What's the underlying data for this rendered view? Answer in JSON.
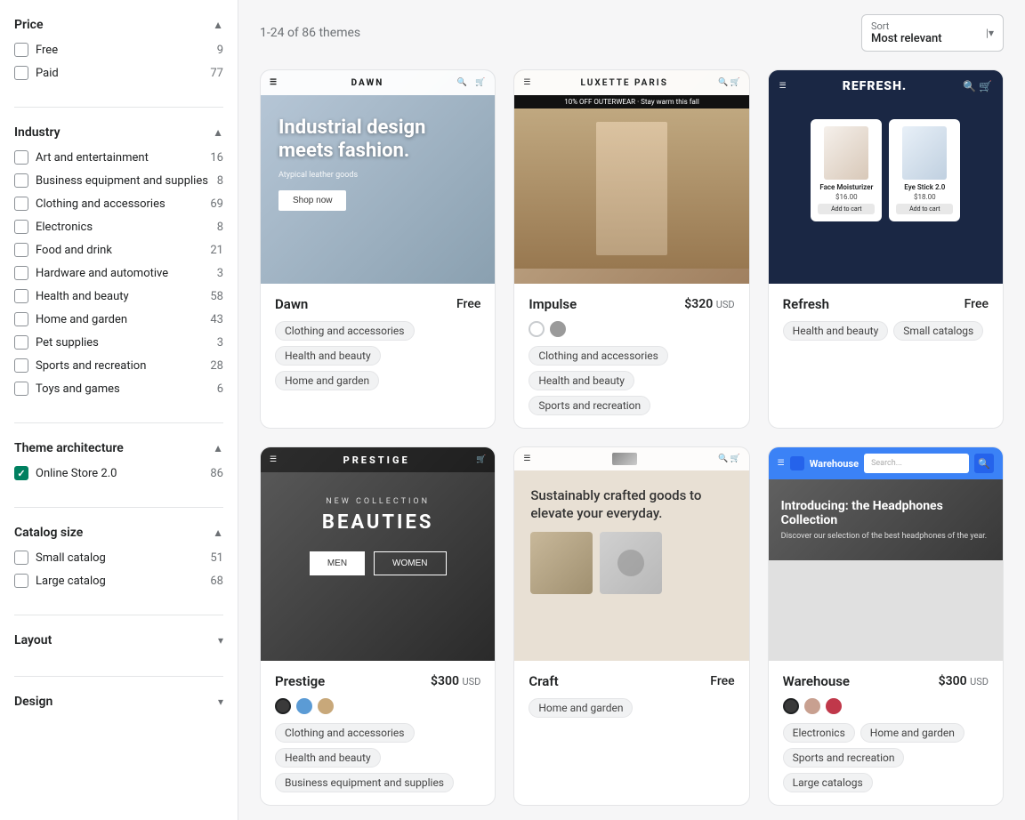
{
  "sidebar": {
    "price_title": "Price",
    "price_items": [
      {
        "label": "Free",
        "count": 9,
        "checked": false
      },
      {
        "label": "Paid",
        "count": 77,
        "checked": false
      }
    ],
    "industry_title": "Industry",
    "industry_items": [
      {
        "label": "Art and entertainment",
        "count": 16,
        "checked": false
      },
      {
        "label": "Business equipment and supplies",
        "count": 8,
        "checked": false
      },
      {
        "label": "Clothing and accessories",
        "count": 69,
        "checked": false
      },
      {
        "label": "Electronics",
        "count": 8,
        "checked": false
      },
      {
        "label": "Food and drink",
        "count": 21,
        "checked": false
      },
      {
        "label": "Hardware and automotive",
        "count": 3,
        "checked": false
      },
      {
        "label": "Health and beauty",
        "count": 58,
        "checked": false
      },
      {
        "label": "Home and garden",
        "count": 43,
        "checked": false
      },
      {
        "label": "Pet supplies",
        "count": 3,
        "checked": false
      },
      {
        "label": "Sports and recreation",
        "count": 28,
        "checked": false
      },
      {
        "label": "Toys and games",
        "count": 6,
        "checked": false
      }
    ],
    "theme_arch_title": "Theme architecture",
    "theme_arch_items": [
      {
        "label": "Online Store 2.0",
        "count": 86,
        "checked": true
      }
    ],
    "catalog_title": "Catalog size",
    "catalog_items": [
      {
        "label": "Small catalog",
        "count": 51,
        "checked": false
      },
      {
        "label": "Large catalog",
        "count": 68,
        "checked": false
      }
    ],
    "layout_title": "Layout",
    "design_title": "Design"
  },
  "header": {
    "results": "1-24 of 86 themes",
    "sort_label": "Sort",
    "sort_value": "Most relevant"
  },
  "themes": [
    {
      "name": "Dawn",
      "price": "Free",
      "is_free": true,
      "preview_type": "dawn",
      "swatches": [],
      "tags": [
        "Clothing and accessories",
        "Health and beauty",
        "Home and garden"
      ]
    },
    {
      "name": "Impulse",
      "price": "$320",
      "currency": "USD",
      "is_free": false,
      "preview_type": "impulse",
      "swatches": [
        {
          "color": "#ffffff",
          "outline": true,
          "selected": true
        },
        {
          "color": "#9a9a9a",
          "outline": false,
          "selected": false
        }
      ],
      "tags": [
        "Clothing and accessories",
        "Health and beauty",
        "Sports and recreation"
      ]
    },
    {
      "name": "Refresh",
      "price": "Free",
      "is_free": true,
      "preview_type": "refresh",
      "swatches": [],
      "tags": [
        "Health and beauty",
        "Small catalogs"
      ]
    },
    {
      "name": "Prestige",
      "price": "$300",
      "currency": "USD",
      "is_free": false,
      "preview_type": "prestige",
      "swatches": [
        {
          "color": "#3a3a3a",
          "outline": false,
          "selected": true
        },
        {
          "color": "#5b9bd5",
          "outline": false,
          "selected": false
        },
        {
          "color": "#c8a87a",
          "outline": false,
          "selected": false
        }
      ],
      "tags": [
        "Clothing and accessories",
        "Health and beauty",
        "Business equipment and supplies"
      ]
    },
    {
      "name": "Craft",
      "price": "Free",
      "is_free": true,
      "preview_type": "craft",
      "swatches": [],
      "tags": [
        "Home and garden"
      ]
    },
    {
      "name": "Warehouse",
      "price": "$300",
      "currency": "USD",
      "is_free": false,
      "preview_type": "warehouse",
      "swatches": [
        {
          "color": "#3a3a3a",
          "outline": false,
          "selected": true
        },
        {
          "color": "#c8a090",
          "outline": false,
          "selected": false
        },
        {
          "color": "#c0384a",
          "outline": false,
          "selected": false
        }
      ],
      "tags": [
        "Electronics",
        "Home and garden",
        "Sports and recreation",
        "Large catalogs"
      ]
    }
  ]
}
